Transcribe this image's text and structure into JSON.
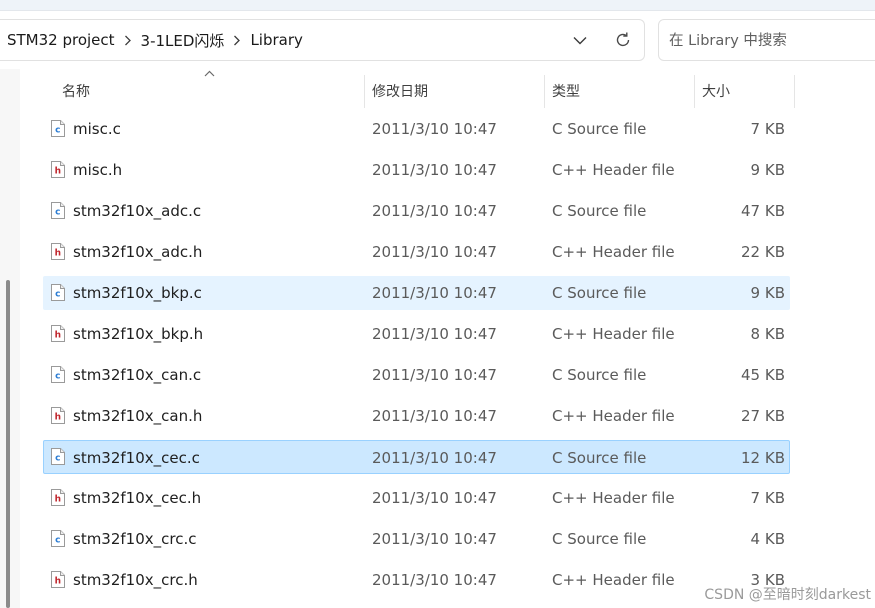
{
  "address_bar": {
    "breadcrumbs": [
      "STM32 project",
      "3-1LED闪烁",
      "Library"
    ]
  },
  "search": {
    "placeholder": "在 Library 中搜索"
  },
  "columns": {
    "name": "名称",
    "date": "修改日期",
    "type": "类型",
    "size": "大小"
  },
  "files": [
    {
      "name": "misc.c",
      "date": "2011/3/10 10:47",
      "type": "C Source file",
      "size": "7 KB",
      "icon": "c-source-file-icon"
    },
    {
      "name": "misc.h",
      "date": "2011/3/10 10:47",
      "type": "C++ Header file",
      "size": "9 KB",
      "icon": "header-file-icon"
    },
    {
      "name": "stm32f10x_adc.c",
      "date": "2011/3/10 10:47",
      "type": "C Source file",
      "size": "47 KB",
      "icon": "c-source-file-icon"
    },
    {
      "name": "stm32f10x_adc.h",
      "date": "2011/3/10 10:47",
      "type": "C++ Header file",
      "size": "22 KB",
      "icon": "header-file-icon"
    },
    {
      "name": "stm32f10x_bkp.c",
      "date": "2011/3/10 10:47",
      "type": "C Source file",
      "size": "9 KB",
      "icon": "c-source-file-icon",
      "state": "hover"
    },
    {
      "name": "stm32f10x_bkp.h",
      "date": "2011/3/10 10:47",
      "type": "C++ Header file",
      "size": "8 KB",
      "icon": "header-file-icon"
    },
    {
      "name": "stm32f10x_can.c",
      "date": "2011/3/10 10:47",
      "type": "C Source file",
      "size": "45 KB",
      "icon": "c-source-file-icon"
    },
    {
      "name": "stm32f10x_can.h",
      "date": "2011/3/10 10:47",
      "type": "C++ Header file",
      "size": "27 KB",
      "icon": "header-file-icon"
    },
    {
      "name": "stm32f10x_cec.c",
      "date": "2011/3/10 10:47",
      "type": "C Source file",
      "size": "12 KB",
      "icon": "c-source-file-icon",
      "state": "selected"
    },
    {
      "name": "stm32f10x_cec.h",
      "date": "2011/3/10 10:47",
      "type": "C++ Header file",
      "size": "7 KB",
      "icon": "header-file-icon"
    },
    {
      "name": "stm32f10x_crc.c",
      "date": "2011/3/10 10:47",
      "type": "C Source file",
      "size": "4 KB",
      "icon": "c-source-file-icon"
    },
    {
      "name": "stm32f10x_crc.h",
      "date": "2011/3/10 10:47",
      "type": "C++ Header file",
      "size": "3 KB",
      "icon": "header-file-icon"
    }
  ],
  "watermark": "CSDN @至暗时刻darkest",
  "colors": {
    "hover_row": "#e5f3ff",
    "selected_row": "#cce8ff",
    "selected_border": "#99d1ff",
    "c_icon_letter": "#2b7cd3",
    "h_icon_letter": "#c0262d"
  }
}
